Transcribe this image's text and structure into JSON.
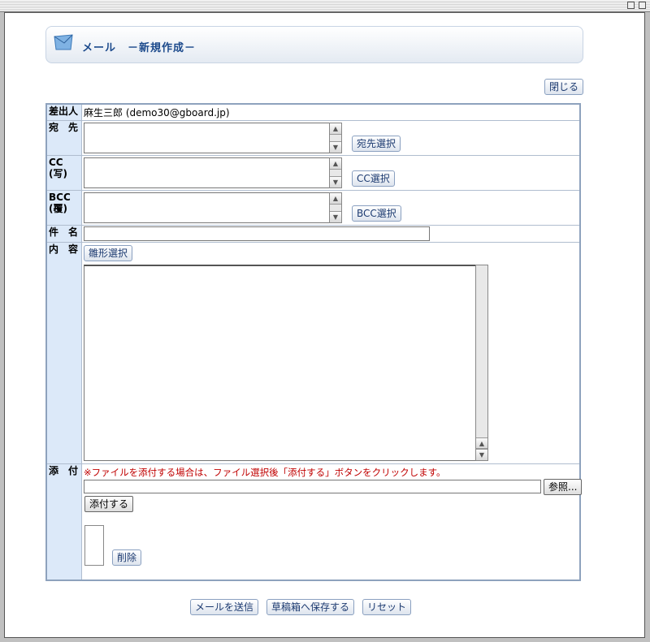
{
  "window": {
    "minimize": "",
    "maximize": ""
  },
  "header": {
    "title": "メール　－新規作成－"
  },
  "toolbar": {
    "close_label": "閉じる"
  },
  "form": {
    "sender": {
      "label": "差出人",
      "value": "麻生三郎 (demo30@gboard.jp)"
    },
    "to": {
      "label": "宛　先",
      "button": "宛先選択"
    },
    "cc": {
      "label": "CC\n(写)",
      "label1": "CC",
      "label2": "(写)",
      "button": "CC選択"
    },
    "bcc": {
      "label1": "BCC",
      "label2": "(覆)",
      "button": "BCC選択"
    },
    "subject": {
      "label": "件　名",
      "value": ""
    },
    "body": {
      "label": "内　容",
      "template_button": "雛形選択",
      "value": ""
    },
    "attach": {
      "label": "添　付",
      "note": "※ファイルを添付する場合は、ファイル選択後「添付する」ボタンをクリックします。",
      "browse_button": "参照...",
      "attach_button": "添付する",
      "delete_button": "削除"
    }
  },
  "footer": {
    "send": "メールを送信",
    "draft": "草稿箱へ保存する",
    "reset": "リセット"
  }
}
